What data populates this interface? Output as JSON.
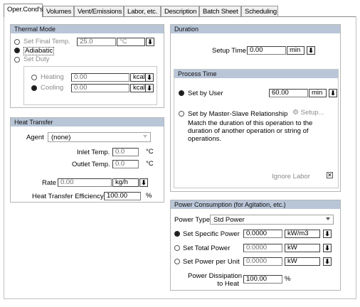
{
  "tabs": [
    {
      "label": "Oper.Cond's"
    },
    {
      "label": "Volumes"
    },
    {
      "label": "Vent/Emissions"
    },
    {
      "label": "Labor, etc."
    },
    {
      "label": "Description"
    },
    {
      "label": "Batch Sheet"
    },
    {
      "label": "Scheduling"
    }
  ],
  "thermal": {
    "title": "Thermal Mode",
    "set_final_temp_label": "Set Final Temp.",
    "final_temp_value": "25.0",
    "final_temp_unit": "°C",
    "adiabatic_label": "Adiabatic",
    "set_duty_label": "Set Duty",
    "heating_label": "Heating",
    "heating_value": "0.00",
    "heating_unit": "kcal/h",
    "cooling_label": "Cooling",
    "cooling_value": "0.00",
    "cooling_unit": "kcal/h",
    "selected": "Adiabatic"
  },
  "heat_transfer": {
    "title": "Heat Transfer",
    "agent_label": "Agent",
    "agent_value": "(none)",
    "inlet_label": "Inlet Temp.",
    "inlet_value": "0.0",
    "inlet_unit": "°C",
    "outlet_label": "Outlet Temp.",
    "outlet_value": "0.0",
    "outlet_unit": "°C",
    "rate_label": "Rate",
    "rate_value": "0.00",
    "rate_unit": "kg/h",
    "efficiency_label": "Heat Transfer Efficiency",
    "efficiency_value": "100.00",
    "efficiency_unit": "%"
  },
  "duration": {
    "title": "Duration",
    "setup_label": "Setup Time",
    "setup_value": "0.00",
    "setup_unit": "min"
  },
  "process_time": {
    "title": "Process Time",
    "set_by_user_label": "Set by User",
    "user_value": "60.00",
    "user_unit": "min",
    "master_slave_label": "Set by Master-Slave Relationship",
    "setup_button_label": "Setup...",
    "description": "Match the duration of this operation to the duration of another operation or string of operations.",
    "ignore_label": "Ignore Labor",
    "selected": "Set by User"
  },
  "power": {
    "title": "Power Consumption (for Agitation, etc.)",
    "type_label": "Power Type",
    "type_value": "Std Power",
    "specific_label": "Set Specific Power",
    "specific_value": "0.0000",
    "specific_unit": "kW/m3",
    "total_label": "Set Total Power",
    "total_value": "0.0000",
    "total_unit": "kW",
    "per_unit_label": "Set Power per Unit",
    "per_unit_value": "0.0000",
    "per_unit_unit": "kW",
    "dissipation_label_1": "Power Dissipation",
    "dissipation_label_2": "to Heat",
    "dissipation_value": "100.00",
    "dissipation_unit": "%",
    "selected": "Set Specific Power"
  }
}
